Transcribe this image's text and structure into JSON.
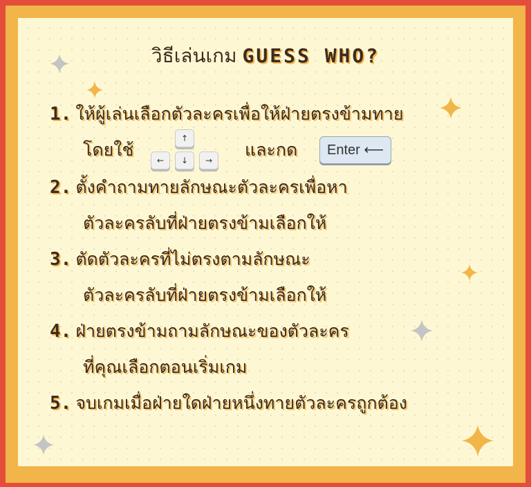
{
  "title": {
    "thai": "วิธีเล่นเกม",
    "game_name": "GUESS WHO?"
  },
  "steps": [
    {
      "number": "1.",
      "lines": [
        "ให้ผู้เล่นเลือกตัวละครเพื่อให้ฝ่ายตรงข้ามทาย"
      ]
    },
    {
      "number": "2.",
      "lines": [
        "ตั้งคำถามทายลักษณะตัวละครเพื่อหา",
        "ตัวละครลับที่ฝ่ายตรงข้ามเลือกให้"
      ]
    },
    {
      "number": "3.",
      "lines": [
        "ตัดตัวละครที่ไม่ตรงตามลักษณะ",
        "ตัวละครลับที่ฝ่ายตรงข้ามเลือกให้"
      ]
    },
    {
      "number": "4.",
      "lines": [
        "ฝ่ายตรงข้ามถามลักษณะของตัวละคร",
        "ที่คุณเลือกตอนเริ่มเกม"
      ]
    },
    {
      "number": "5.",
      "lines": [
        "จบเกมเมื่อฝ่ายใดฝ่ายหนึ่งทายตัวละครถูกต้อง"
      ]
    }
  ],
  "controls": {
    "use_label": "โดยใช้",
    "and_press_label": "และกด",
    "arrow_keys": {
      "up": "↑",
      "left": "←",
      "down": "↓",
      "right": "→"
    },
    "enter_label": "Enter ⟵"
  },
  "colors": {
    "outer_border": "#e44d3a",
    "inner_border": "#f2b54a",
    "panel_bg": "#fdf8d3",
    "text": "#3d2b20",
    "star_gold": "#f2b54a",
    "star_gray": "#c4c4c4"
  }
}
